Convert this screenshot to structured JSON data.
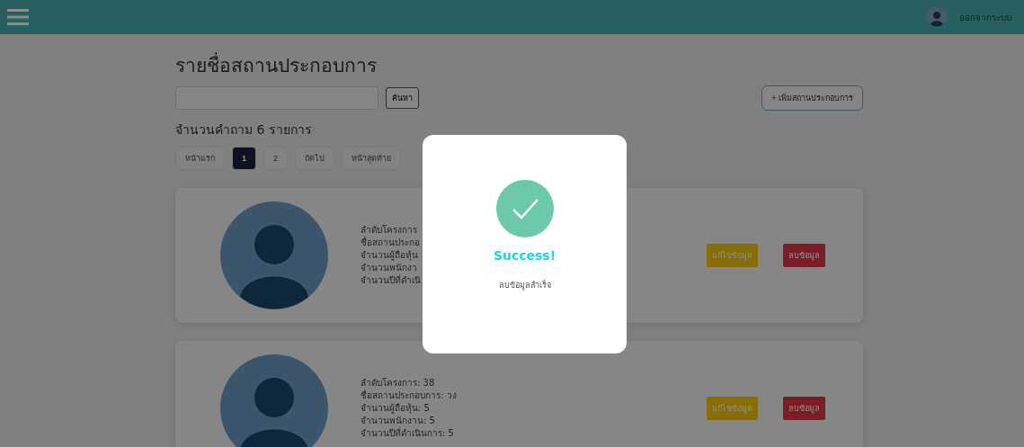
{
  "topbar": {
    "logout": "ออกจากระบบ"
  },
  "title": "รายชื่อสถานประกอบการ",
  "search": {
    "button": "ค้นหา"
  },
  "add_button": "+ เพิ่มสถานประกอบการ",
  "count": "จำนวนคำถาม 6 รายการ",
  "pagination": [
    {
      "label": "หน้าแรก",
      "selected": false
    },
    {
      "label": "1",
      "selected": true
    },
    {
      "label": "2",
      "selected": false
    },
    {
      "label": "ถัดไป",
      "selected": false
    },
    {
      "label": "หน้าสุดท้าย",
      "selected": false
    }
  ],
  "cards": [
    {
      "lines": [
        "ลำดับโครงการ",
        "ชื่อสถานประกอ",
        "จำนวนผู้ถือหุ้น",
        "จำนวนพนักงา",
        "จำนวนปีที่ดำเนิ"
      ],
      "edit": "แก้ไขข้อมูล",
      "delete": "ลบข้อมูล"
    },
    {
      "lines": [
        "ลำดับโครงการ: 38",
        "ชื่อสถานประกอบการ: วง",
        "จำนวนผู้ถือหุ้น: 5",
        "จำนวนพนักงาน: 5",
        "จำนวนปีที่ดำเนินการ: 5"
      ],
      "edit": "แก้ไขข้อมูล",
      "delete": "ลบข้อมูล"
    }
  ],
  "modal": {
    "title": "Success!",
    "message": "ลบข้อมูลสำเร็จ"
  }
}
